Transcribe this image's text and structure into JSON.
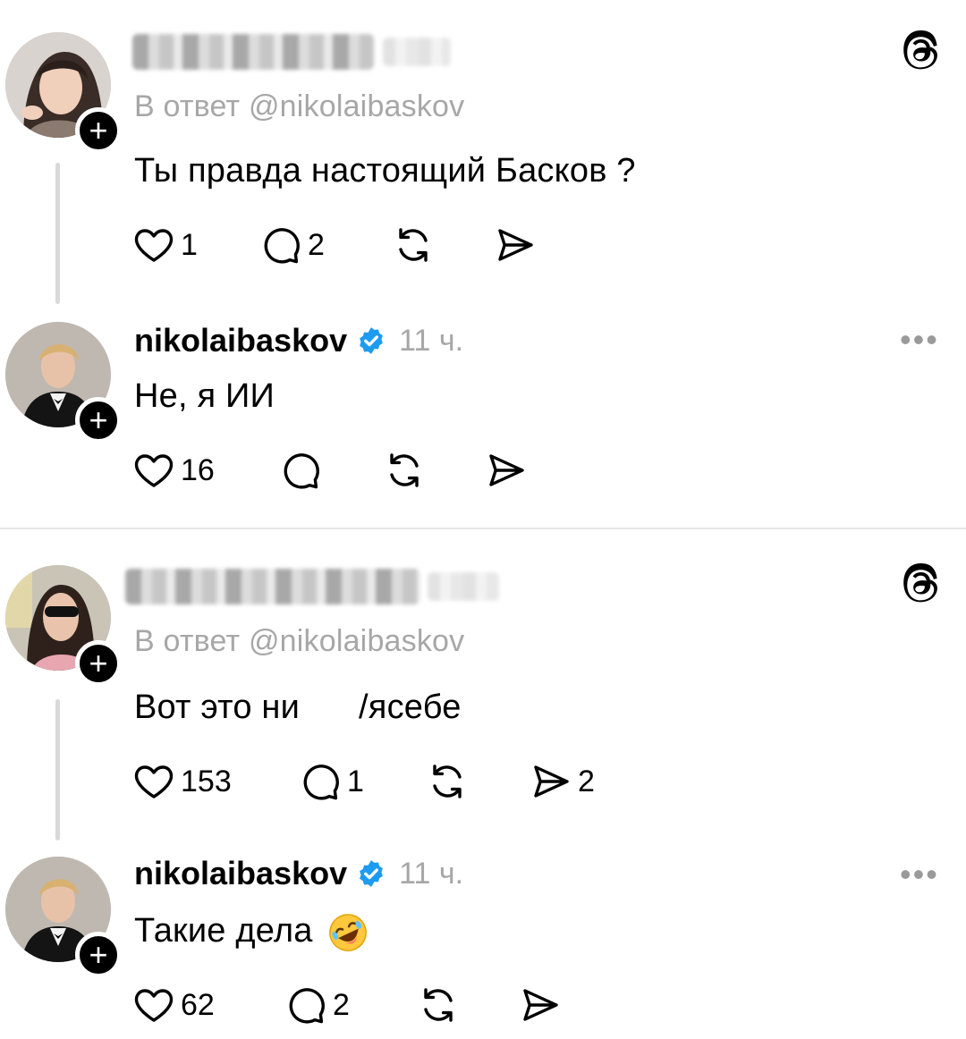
{
  "posts": [
    {
      "username_visible": false,
      "reply_to": "В ответ @nikolaibaskov",
      "text": "Ты правда настоящий Басков ?",
      "likes": "1",
      "replies": "2",
      "reposts": "",
      "shares": ""
    },
    {
      "author": "nikolaibaskov",
      "time": "11 ч.",
      "text": "Не, я ИИ",
      "likes": "16",
      "replies": "",
      "reposts": "",
      "shares": ""
    },
    {
      "username_visible": false,
      "reply_to": "В ответ @nikolaibaskov",
      "text_before": "Вот это ни",
      "text_after": "/ясебе",
      "likes": "153",
      "replies": "1",
      "reposts": "",
      "shares": "2"
    },
    {
      "author": "nikolaibaskov",
      "time": "11 ч.",
      "text": "Такие дела",
      "likes": "62",
      "replies": "2",
      "reposts": "",
      "shares": ""
    }
  ],
  "icons": {
    "like": "heart-icon",
    "reply": "comment-icon",
    "repost": "repost-icon",
    "share": "share-icon",
    "logo": "threads-logo-icon",
    "more": "more-icon",
    "verified": "verified-badge-icon"
  },
  "colors": {
    "text": "#000000",
    "muted": "#a7a7a7",
    "verified": "#1d9bf0",
    "divider": "#e6e6e6"
  }
}
